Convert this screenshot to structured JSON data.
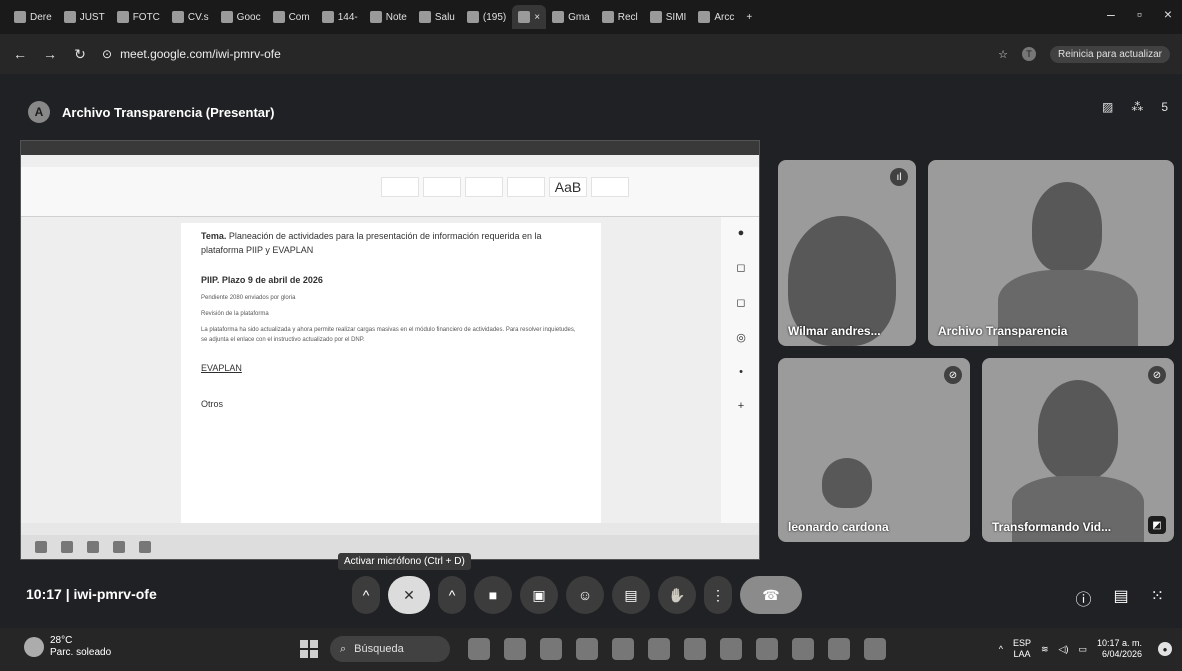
{
  "browser": {
    "tabs": [
      "Dere",
      "JUST",
      "FOTC",
      "CV.s",
      "Gooc",
      "Com",
      "144-",
      "Note",
      "Salu",
      "(195)",
      "",
      "Gma",
      "Recl",
      "SIMI",
      "Arcc"
    ],
    "url": "meet.google.com/iwi-pmrv-ofe",
    "profile_initial": "T",
    "update_label": "Reinicia para actualizar"
  },
  "meet": {
    "presenter_initial": "A",
    "presenting_title": "Archivo Transparencia (Presentar)",
    "participant_count": "5",
    "time": "10:17",
    "separator": "|",
    "meeting_code": "iwi-pmrv-ofe",
    "tooltip": "Activar micrófono (Ctrl + D)"
  },
  "document": {
    "tema_label": "Tema.",
    "tema_text": "Planeación de actividades para la presentación de información requerida en la plataforma PIIP y EVAPLAN",
    "heading": "PIIP. Plazo 9 de abril de 2026",
    "line1": "Pendiente 2080 enviados por gloria",
    "line2": "Revisión de la plataforma",
    "line3": "La plataforma ha sido actualizada y ahora permite realizar cargas masivas en el módulo financiero de actividades. Para resolver inquietudes, se adjunta el enlace con el instructivo actualizado por el DNP.",
    "evaplan": "EVAPLAN",
    "otros": "Otros",
    "style_sample": "AaB"
  },
  "participants": [
    {
      "name": "Wilmar andres..."
    },
    {
      "name": "Archivo Transparencia"
    },
    {
      "name": "leonardo cardona"
    },
    {
      "name": "Transformando Vid..."
    }
  ],
  "taskbar": {
    "temperature": "28°C",
    "weather": "Parc. soleado",
    "search": "Búsqueda",
    "lang1": "ESP",
    "lang2": "LAA",
    "time": "10:17 a. m.",
    "date": "6/04/2026"
  }
}
